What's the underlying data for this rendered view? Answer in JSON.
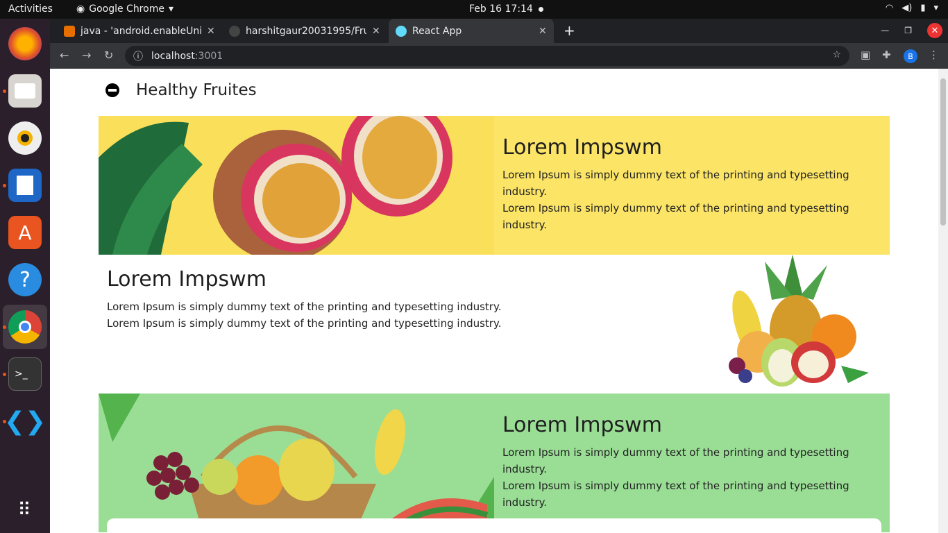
{
  "system": {
    "activities": "Activities",
    "app_name": "Google Chrome",
    "clock": "Feb 16  17:14"
  },
  "browser": {
    "tabs": [
      {
        "title": "java - 'android.enableUnit",
        "active": false
      },
      {
        "title": "harshitgaur20031995/Fru",
        "active": false
      },
      {
        "title": "React App",
        "active": true
      }
    ],
    "address": {
      "host": "localhost",
      "port": ":3001"
    },
    "profile_initial": "B"
  },
  "page": {
    "header_title": "Healthy Fruites",
    "sections": [
      {
        "heading": "Lorem Impswm",
        "lines": [
          "Lorem Ipsum is simply dummy text of the printing and typesetting industry.",
          "Lorem Ipsum is simply dummy text of the printing and typesetting industry."
        ],
        "background": "#fbe466"
      },
      {
        "heading": "Lorem Impswm",
        "lines": [
          "Lorem Ipsum is simply dummy text of the printing and typesetting industry.",
          "Lorem Ipsum is simply dummy text of the printing and typesetting industry."
        ],
        "background": "#ffffff"
      },
      {
        "heading": "Lorem Impswm",
        "lines": [
          "Lorem Ipsum is simply dummy text of the printing and typesetting industry.",
          "Lorem Ipsum is simply dummy text of the printing and typesetting industry."
        ],
        "background": "#9ade96"
      }
    ]
  }
}
